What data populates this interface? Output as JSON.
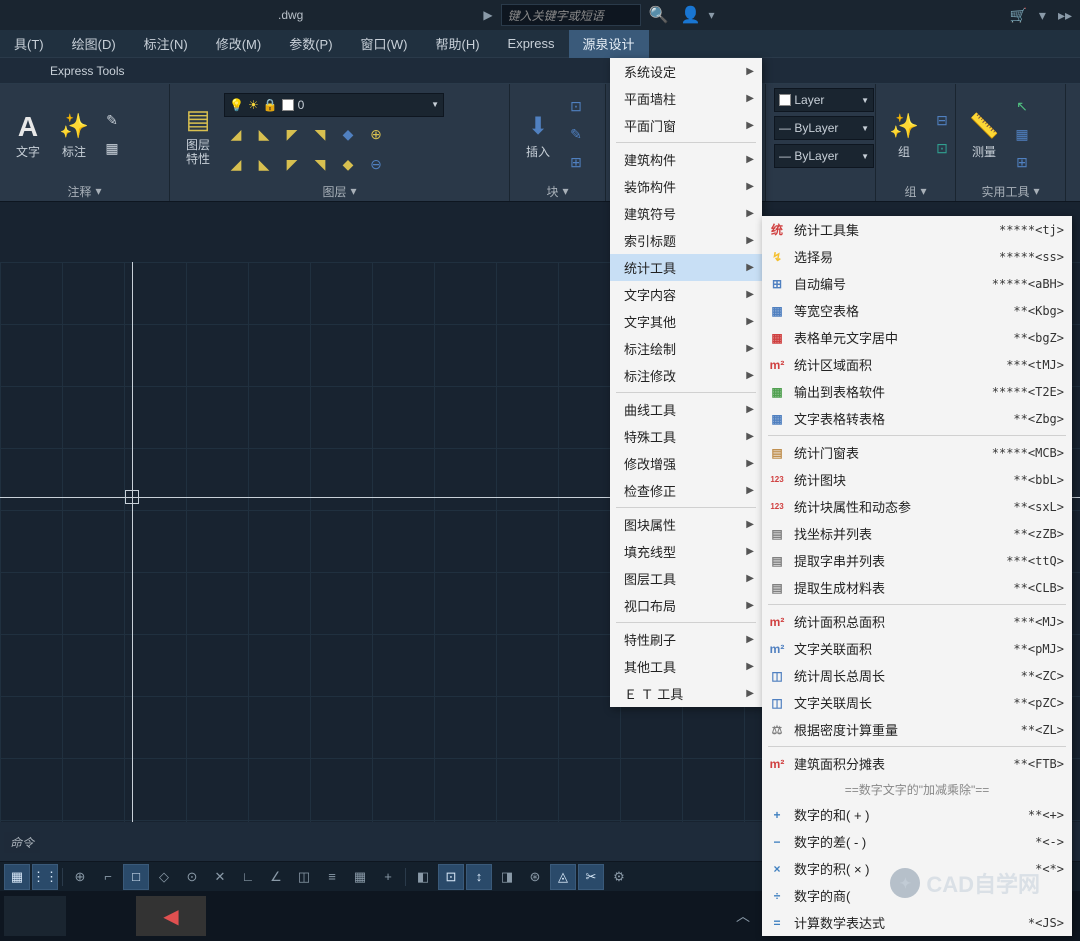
{
  "title": ".dwg",
  "search_placeholder": "键入关键字或短语",
  "menu": [
    {
      "l": "具(T)"
    },
    {
      "l": "绘图(D)"
    },
    {
      "l": "标注(N)"
    },
    {
      "l": "修改(M)"
    },
    {
      "l": "参数(P)"
    },
    {
      "l": "窗口(W)"
    },
    {
      "l": "帮助(H)"
    },
    {
      "l": "Express"
    },
    {
      "l": "源泉设计",
      "open": true
    }
  ],
  "tab_express": "Express Tools",
  "ribbon": {
    "annot": {
      "text": "文字",
      "dim": "标注",
      "label": "注释"
    },
    "layer": {
      "props": "图层\n特性",
      "label": "图层",
      "current": "0"
    },
    "block": {
      "insert": "插入",
      "label": "块"
    },
    "props": {
      "bylayer1": "Layer",
      "bylayer2": "ByLayer",
      "bylayer3": "ByLayer"
    },
    "group": {
      "btn": "组",
      "label": "组"
    },
    "util": {
      "btn": "测量",
      "label": "实用工具"
    }
  },
  "dropdown": [
    {
      "l": "系统设定",
      "sub": true
    },
    {
      "l": "平面墙柱",
      "sub": true
    },
    {
      "l": "平面门窗",
      "sub": true
    },
    {
      "sep": true
    },
    {
      "l": "建筑构件",
      "sub": true
    },
    {
      "l": "装饰构件",
      "sub": true
    },
    {
      "l": "建筑符号",
      "sub": true
    },
    {
      "l": "索引标题",
      "sub": true
    },
    {
      "l": "统计工具",
      "sub": true,
      "hover": true
    },
    {
      "l": "文字内容",
      "sub": true
    },
    {
      "l": "文字其他",
      "sub": true
    },
    {
      "l": "标注绘制",
      "sub": true
    },
    {
      "l": "标注修改",
      "sub": true
    },
    {
      "sep": true
    },
    {
      "l": "曲线工具",
      "sub": true
    },
    {
      "l": "特殊工具",
      "sub": true
    },
    {
      "l": "修改增强",
      "sub": true
    },
    {
      "l": "检查修正",
      "sub": true
    },
    {
      "sep": true
    },
    {
      "l": "图块属性",
      "sub": true
    },
    {
      "l": "填充线型",
      "sub": true
    },
    {
      "l": "图层工具",
      "sub": true
    },
    {
      "l": "视口布局",
      "sub": true
    },
    {
      "sep": true
    },
    {
      "l": "特性刷子",
      "sub": true
    },
    {
      "l": "其他工具",
      "sub": true
    },
    {
      "l": "Ｅ Ｔ 工具",
      "sub": true
    }
  ],
  "submenu": [
    {
      "ic": "统",
      "cl": "#d04040",
      "l": "统计工具集",
      "s": "*****<tj>"
    },
    {
      "ic": "↯",
      "cl": "#f4c030",
      "l": "选择易",
      "s": "*****<ss>"
    },
    {
      "ic": "⊞",
      "cl": "#5080c0",
      "l": "自动编号",
      "s": "*****<aBH>"
    },
    {
      "ic": "▦",
      "cl": "#5080c0",
      "l": "等宽空表格",
      "s": "**<Kbg>"
    },
    {
      "ic": "▦",
      "cl": "#d04040",
      "l": "表格单元文字居中",
      "s": "**<bgZ>"
    },
    {
      "ic": "m²",
      "cl": "#d04040",
      "l": "统计区域面积",
      "s": "***<tMJ>"
    },
    {
      "ic": "▦",
      "cl": "#50a050",
      "l": "输出到表格软件",
      "s": "*****<T2E>"
    },
    {
      "ic": "▦",
      "cl": "#5080c0",
      "l": "文字表格转表格",
      "s": "**<Zbg>"
    },
    {
      "sep": true
    },
    {
      "ic": "▤",
      "cl": "#c09050",
      "l": "统计门窗表",
      "s": "*****<MCB>"
    },
    {
      "ic": "123",
      "cl": "#d04040",
      "l": "统计图块",
      "s": "**<bbL>"
    },
    {
      "ic": "123",
      "cl": "#d04040",
      "l": "统计块属性和动态参",
      "s": "**<sxL>"
    },
    {
      "ic": "▤",
      "cl": "#808080",
      "l": "找坐标并列表",
      "s": "**<zZB>"
    },
    {
      "ic": "▤",
      "cl": "#808080",
      "l": "提取字串并列表",
      "s": "***<ttQ>"
    },
    {
      "ic": "▤",
      "cl": "#808080",
      "l": "提取生成材料表",
      "s": "**<CLB>"
    },
    {
      "sep": true
    },
    {
      "ic": "m²",
      "cl": "#d04040",
      "l": "统计面积总面积",
      "s": "***<MJ>"
    },
    {
      "ic": "m²",
      "cl": "#5080c0",
      "l": "文字关联面积",
      "s": "**<pMJ>"
    },
    {
      "ic": "◫",
      "cl": "#5080c0",
      "l": "统计周长总周长",
      "s": "**<ZC>"
    },
    {
      "ic": "◫",
      "cl": "#5080c0",
      "l": "文字关联周长",
      "s": "**<pZC>"
    },
    {
      "ic": "⚖",
      "cl": "#808080",
      "l": "根据密度计算重量",
      "s": "**<ZL>"
    },
    {
      "sep": true
    },
    {
      "ic": "m²",
      "cl": "#d04040",
      "l": "建筑面积分摊表",
      "s": "**<FTB>"
    },
    {
      "header": "==数字文字的\"加减乘除\"=="
    },
    {
      "ic": "+",
      "cl": "#4080c0",
      "l": "数字的和( + )",
      "s": "**<+>"
    },
    {
      "ic": "−",
      "cl": "#4080c0",
      "l": "数字的差( - )",
      "s": "*<->"
    },
    {
      "ic": "×",
      "cl": "#4080c0",
      "l": "数字的积( × )",
      "s": "*<*>"
    },
    {
      "ic": "÷",
      "cl": "#4080c0",
      "l": "数字的商( ",
      "s": ""
    },
    {
      "ic": "=",
      "cl": "#4080c0",
      "l": "计算数学表达式",
      "s": "*<JS>"
    }
  ],
  "cmd": "命令",
  "status_icons": [
    "▦",
    "⋮⋮",
    "⊕",
    "⌐",
    "□",
    "◇",
    "⊙",
    "✕",
    "∟",
    "∠",
    "◫",
    "≡",
    "▦",
    "+",
    "◧",
    "⊡",
    "↕",
    "◨",
    "⊛",
    "◬",
    "✂",
    "⚙"
  ],
  "watermark": "CAD自学网"
}
